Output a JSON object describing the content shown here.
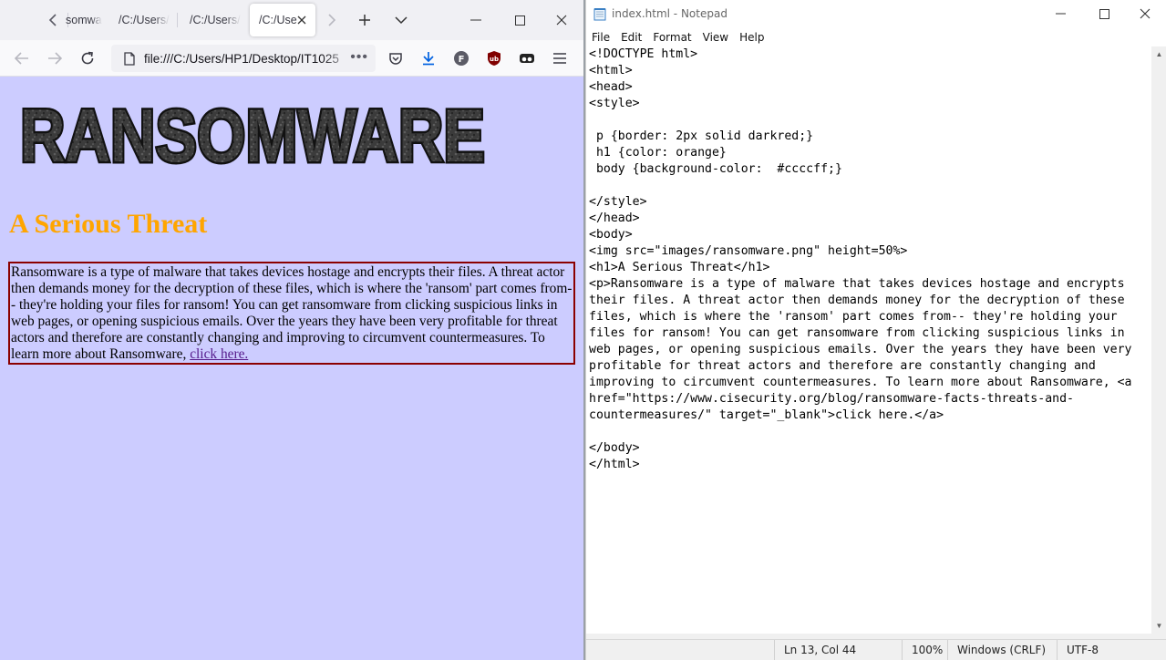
{
  "browser": {
    "tabs": [
      {
        "label": "somwa",
        "active": false
      },
      {
        "label": "/C:/Users/",
        "active": false
      },
      {
        "label": "/C:/Users/",
        "active": false
      },
      {
        "label": "/C:/Use",
        "active": true
      }
    ],
    "url": "file:///C:/Users/HP1/Desktop/IT1025",
    "page": {
      "logo_text": "RANSOMWARE",
      "heading": "A Serious Threat",
      "paragraph_text": "Ransomware is a type of malware that takes devices hostage and encrypts their files. A threat actor then demands money for the decryption of these files, which is where the 'ransom' part comes from-- they're holding your files for ransom! You can get ransomware from clicking suspicious links in web pages, or opening suspicious emails. Over the years they have been very profitable for threat actors and therefore are constantly changing and improving to circumvent countermeasures. To learn more about Ransomware,",
      "link_text": "click here.",
      "background_color": "#ccccff",
      "heading_color": "orange",
      "border_color": "darkred",
      "link_color": "#551a8b"
    },
    "toolbar_icons": [
      "back-icon",
      "forward-icon",
      "reload-icon",
      "pocket-icon",
      "download-icon",
      "account-icon",
      "ublock-icon",
      "tab-manager-icon",
      "menu-icon"
    ]
  },
  "notepad": {
    "title": "index.html - Notepad",
    "menu": [
      "File",
      "Edit",
      "Format",
      "View",
      "Help"
    ],
    "code_lines": [
      "<!DOCTYPE html>",
      "<html>",
      "<head>",
      "<style>",
      "",
      " p {border: 2px solid darkred;}",
      " h1 {color: orange}",
      " body {background-color:  #ccccff;}",
      "",
      "</style>",
      "</head>",
      "<body>",
      "<img src=\"images/ransomware.png\" height=50%>",
      "<h1>A Serious Threat</h1>",
      "<p>Ransomware is a type of malware that takes devices hostage and encrypts",
      "their files. A threat actor then demands money for the decryption of these",
      "files, which is where the 'ransom' part comes from-- they're holding your",
      "files for ransom! You can get ransomware from clicking suspicious links in",
      "web pages, or opening suspicious emails. Over the years they have been very",
      "profitable for threat actors and therefore are constantly changing and",
      "improving to circumvent countermeasures. To learn more about Ransomware, <a",
      "href=\"https://www.cisecurity.org/blog/ransomware-facts-threats-and-",
      "countermeasures/\" target=\"_blank\">click here.</a>",
      "",
      "</body>",
      "</html>"
    ],
    "status": {
      "position": "Ln 13, Col 44",
      "zoom": "100%",
      "line_endings": "Windows (CRLF)",
      "encoding": "UTF-8"
    }
  }
}
